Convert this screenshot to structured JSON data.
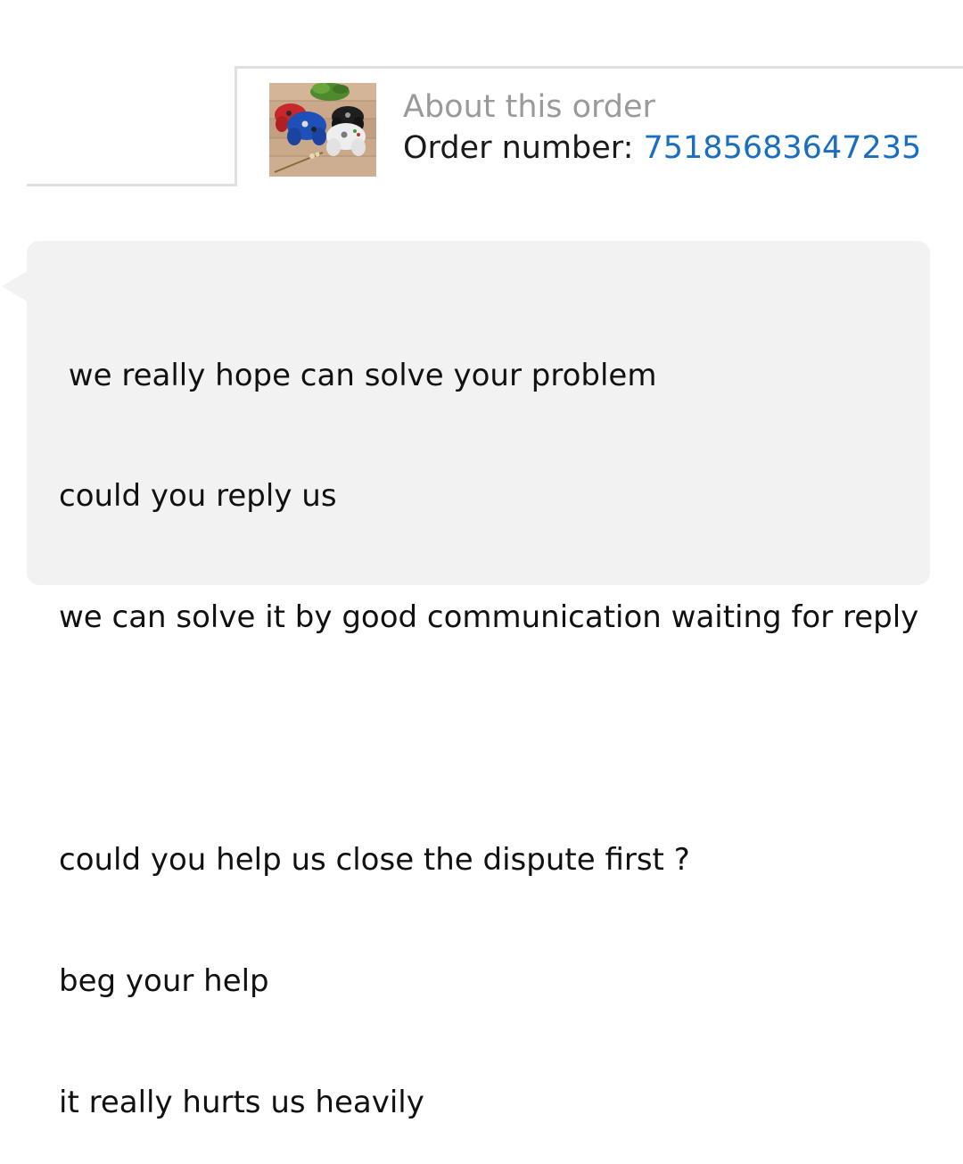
{
  "order": {
    "title": "About this order",
    "number_label": "Order number: ",
    "number_value": "75185683647235",
    "thumbnail_icon": "game-controllers-product-image"
  },
  "message": {
    "lines": [
      " we really hope can solve your problem",
      "could you reply us",
      "we can solve it by good communication waiting for reply",
      "",
      "could you help us close the dispute first ?",
      "beg your help",
      "it really hurts us heavily"
    ]
  },
  "colors": {
    "accent_link": "#1a6ec2",
    "bubble_bg": "#f2f2f2",
    "muted_text": "#9a9a9a"
  }
}
